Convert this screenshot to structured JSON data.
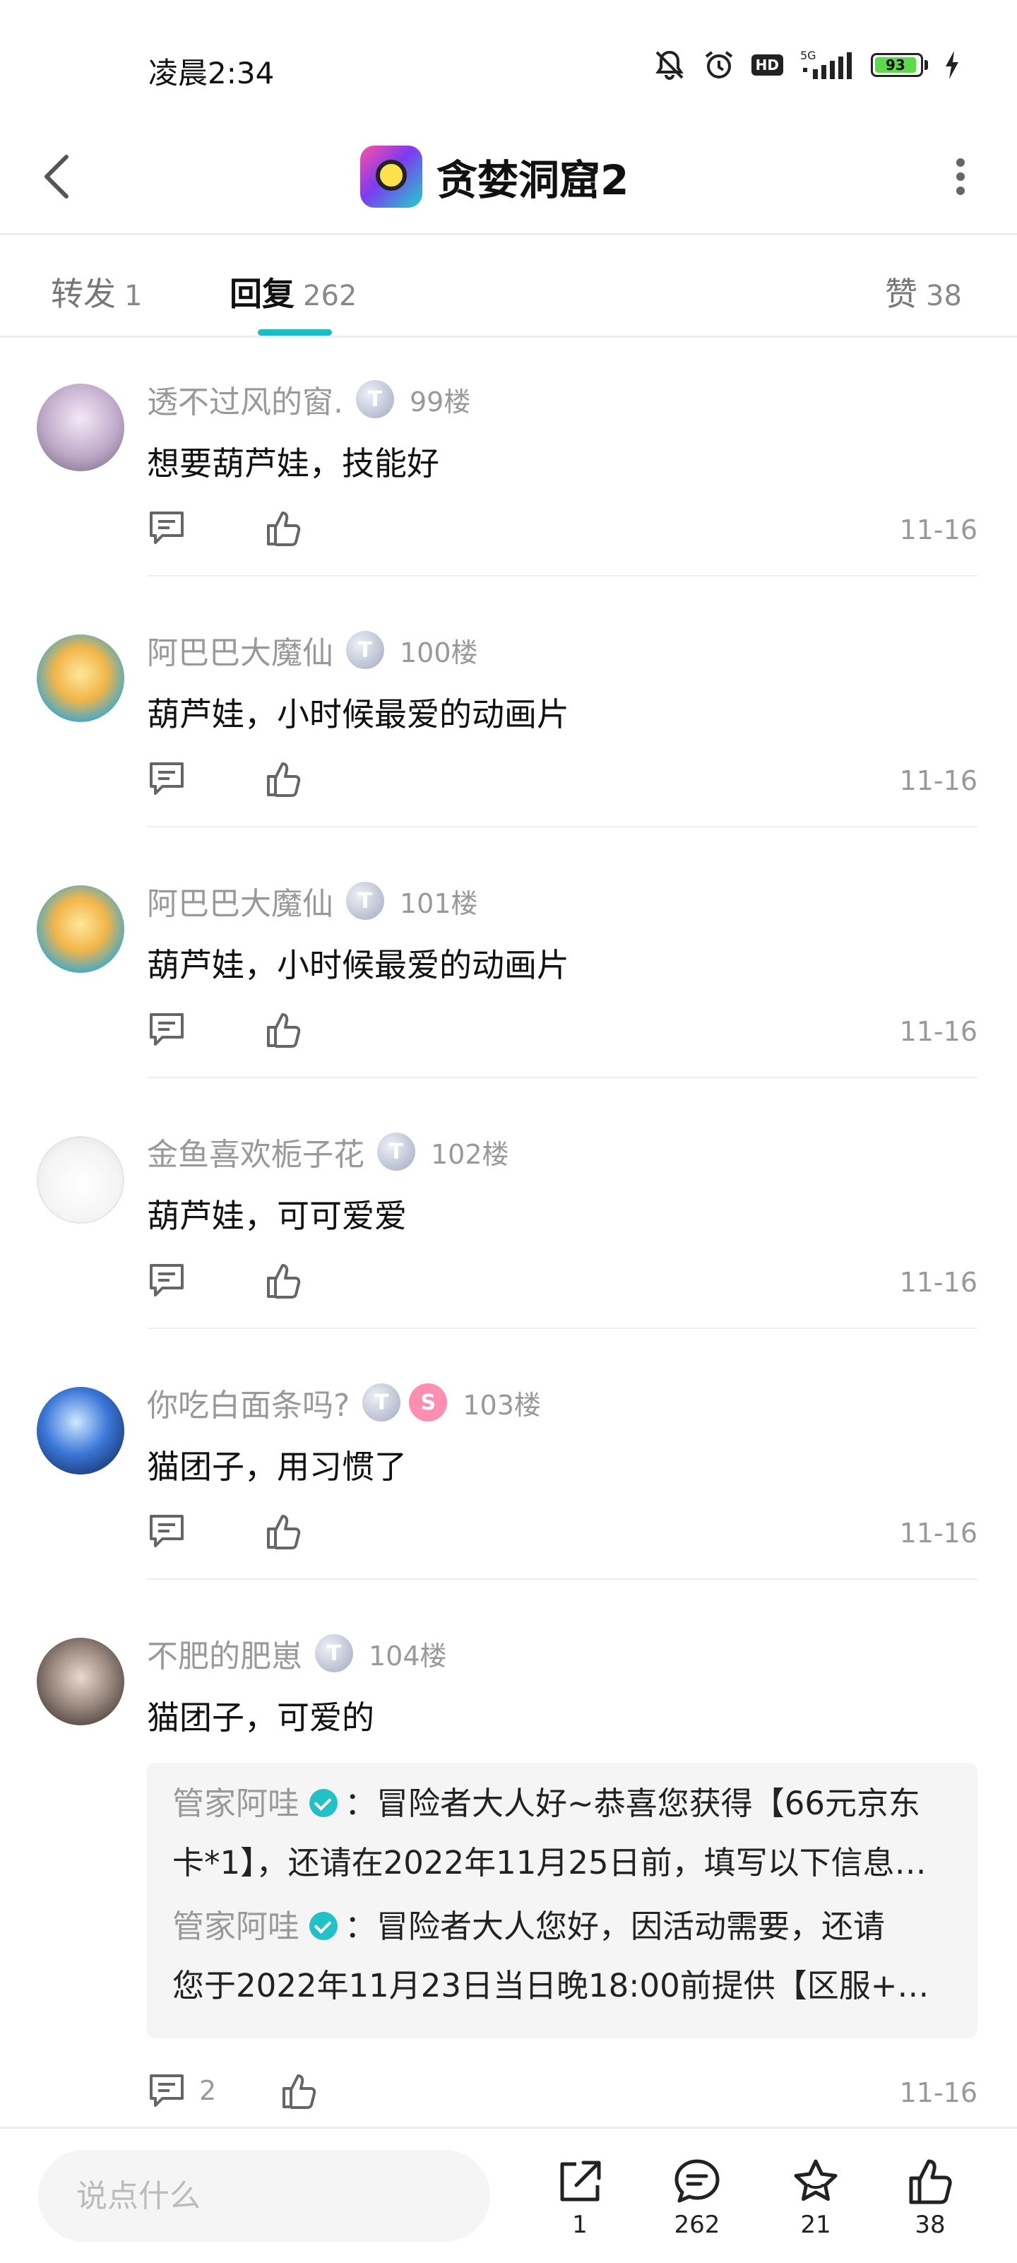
{
  "status_bar": {
    "time": "凌晨2:34",
    "hd": "HD",
    "network": "5G",
    "battery": "93",
    "battery_level": 0.93
  },
  "header": {
    "title": "贪婪洞窟2"
  },
  "tabs": [
    {
      "label": "转发",
      "count": "1"
    },
    {
      "label": "回复",
      "count": "262"
    },
    {
      "label": "赞",
      "count": "38"
    }
  ],
  "comments": [
    {
      "name": "透不过风的窗.",
      "floor": "99楼",
      "text": "想要葫芦娃，技能好",
      "date": "11-16"
    },
    {
      "name": "阿巴巴大魔仙",
      "floor": "100楼",
      "text": "葫芦娃，小时候最爱的动画片",
      "date": "11-16"
    },
    {
      "name": "阿巴巴大魔仙",
      "floor": "101楼",
      "text": "葫芦娃，小时候最爱的动画片",
      "date": "11-16"
    },
    {
      "name": "金鱼喜欢栀子花",
      "floor": "102楼",
      "text": "葫芦娃，可可爱爱",
      "date": "11-16"
    },
    {
      "name": "你吃白面条吗?",
      "floor": "103楼",
      "text": "猫团子，用习惯了",
      "date": "11-16"
    },
    {
      "name": "不肥的肥崽",
      "floor": "104楼",
      "text": "猫团子，可爱的",
      "date": "11-16",
      "reply_count": "2"
    }
  ],
  "badges": {
    "t": "T",
    "s": "S"
  },
  "sub_replies": [
    {
      "name": "管家阿哇",
      "line1": "：冒险者大人好~恭喜您获得【66元京东",
      "line2": "卡*1】，还请在2022年11月25日前，填写以下信息…"
    },
    {
      "name": "管家阿哇",
      "line1": "：冒险者大人您好，因活动需要，还请",
      "line2": "您于2022年11月23日当日晚18:00前提供【区服+…"
    }
  ],
  "bottom_bar": {
    "placeholder": "说点什么",
    "share_count": "1",
    "comment_count": "262",
    "favorite_count": "21",
    "like_count": "38"
  },
  "colors": {
    "accent": "#1cbcc4",
    "verify": "#22c1c7",
    "battery": "#5ed94b"
  }
}
